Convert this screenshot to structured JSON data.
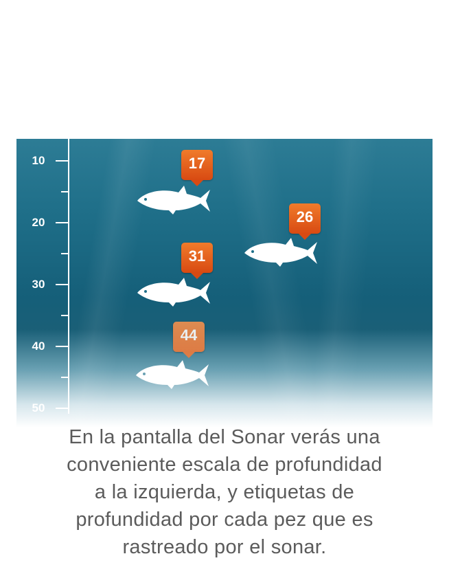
{
  "depth_scale": {
    "labels": [
      "10",
      "20",
      "30",
      "40",
      "50"
    ]
  },
  "fish_targets": [
    {
      "depth_label": "17",
      "depth": 17
    },
    {
      "depth_label": "26",
      "depth": 26
    },
    {
      "depth_label": "31",
      "depth": 31
    },
    {
      "depth_label": "44",
      "depth": 44
    }
  ],
  "caption": {
    "lines": [
      "En la pantalla del Sonar verás una",
      "conveniente escala de profundidad",
      "a la izquierda, y etiquetas de",
      "profundidad por cada pez que es",
      "rastreado por el sonar."
    ]
  },
  "colors": {
    "water_top": "#2d7c95",
    "water_deep": "#155f79",
    "badge": "#d84a12",
    "caption_text": "#5b5b5b"
  },
  "icons": [
    "fish-icon",
    "depth-badge"
  ]
}
